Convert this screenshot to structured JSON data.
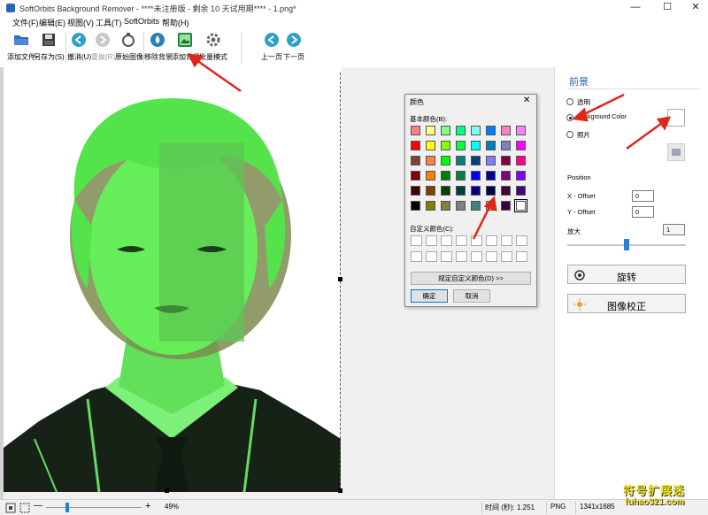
{
  "window": {
    "title": "SoftOrbits Background Remover - ****未注册版 - 剩余 10 天试用期**** - 1.png*",
    "controls": [
      "—",
      "☐",
      "✕"
    ]
  },
  "menu": [
    "文件(F)",
    "编辑(E)",
    "视图(V)",
    "工具(T)",
    "SoftOrbits",
    "帮助(H)"
  ],
  "toolbar": {
    "add_file": "添加文件",
    "save_as": "另存为(S)",
    "undo": "撤消(U)",
    "redo": "重做(R)",
    "original": "原始图像",
    "remove_bg": "移除背景",
    "add_bg": "添加背景",
    "batch": "批量模式",
    "prev": "上一页",
    "next": "下一页"
  },
  "color_dialog": {
    "title": "颜色",
    "close": "✕",
    "basic_colors_label": "基本颜色(B):",
    "custom_colors_label": "自定义颜色(C):",
    "define_custom": "规定自定义颜色(D) >>",
    "ok": "确定",
    "cancel": "取消",
    "basic_colors": [
      "#ff8080",
      "#ffff80",
      "#80ff80",
      "#00ff80",
      "#80ffff",
      "#0080ff",
      "#ff80c0",
      "#ff80ff",
      "#ff0000",
      "#ffff00",
      "#80ff00",
      "#00ff40",
      "#00ffff",
      "#0080c0",
      "#8080c0",
      "#ff00ff",
      "#804040",
      "#ff8040",
      "#00ff00",
      "#008080",
      "#004080",
      "#8080ff",
      "#800040",
      "#ff0080",
      "#800000",
      "#ff8000",
      "#008000",
      "#008040",
      "#0000ff",
      "#0000a0",
      "#800080",
      "#8000ff",
      "#400000",
      "#804000",
      "#004000",
      "#004040",
      "#000080",
      "#000040",
      "#400040",
      "#400080",
      "#000000",
      "#808000",
      "#808040",
      "#808080",
      "#408080",
      "#c0c0c0",
      "#400040",
      "#ffffff"
    ]
  },
  "right_panel": {
    "header": "前景",
    "transparent": "透明",
    "background_color": "Background Color",
    "photo": "照片",
    "position": "Position",
    "x_offset_label": "X - Offset",
    "x_offset_value": "0",
    "y_offset_label": "Y - Offset",
    "y_offset_value": "0",
    "zoom_label": "放大",
    "zoom_value": "1",
    "zoom_slider_fraction": 0.5,
    "rotate": "旋转",
    "correct": "图像校正"
  },
  "statusbar": {
    "zoom_minus": "—",
    "zoom_plus": "+",
    "zoom_pct": "49%",
    "zoom_slider_fraction": 0.22,
    "time": "时间 (秒): 1.251",
    "format": "PNG",
    "dimensions": "1341x1685"
  },
  "watermark": {
    "cn": "符号扩展迷",
    "url": "fuhao321.com"
  },
  "colors": {
    "accent_blue": "#2a64b6",
    "green_overlay": "#66ee5a",
    "arrow_red": "#e0261b",
    "watermark_yellow": "#f2e31f"
  }
}
